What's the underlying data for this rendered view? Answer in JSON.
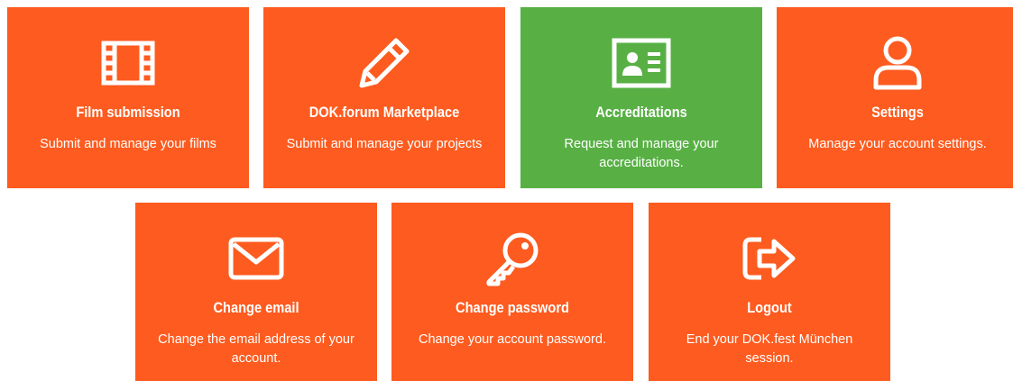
{
  "colors": {
    "orange": "#fd5b1f",
    "green": "#58b044",
    "text": "#ffffff"
  },
  "tiles": [
    {
      "id": "film",
      "icon": "film-icon",
      "color": "orange",
      "title": "Film submission",
      "description": "Submit and manage your films"
    },
    {
      "id": "market",
      "icon": "pencil-icon",
      "color": "orange",
      "title": "DOK.forum Marketplace",
      "description": "Submit and manage your projects"
    },
    {
      "id": "accred",
      "icon": "id-card-icon",
      "color": "green",
      "title": "Accreditations",
      "description": "Request and manage your accreditations."
    },
    {
      "id": "settings",
      "icon": "user-icon",
      "color": "orange",
      "title": "Settings",
      "description": "Manage your account settings."
    },
    {
      "id": "email",
      "icon": "envelope-icon",
      "color": "orange",
      "title": "Change email",
      "description": "Change the email address of your account."
    },
    {
      "id": "password",
      "icon": "key-icon",
      "color": "orange",
      "title": "Change password",
      "description": "Change your account password."
    },
    {
      "id": "logout",
      "icon": "sign-out-icon",
      "color": "orange",
      "title": "Logout",
      "description": "End your DOK.fest München session."
    }
  ]
}
